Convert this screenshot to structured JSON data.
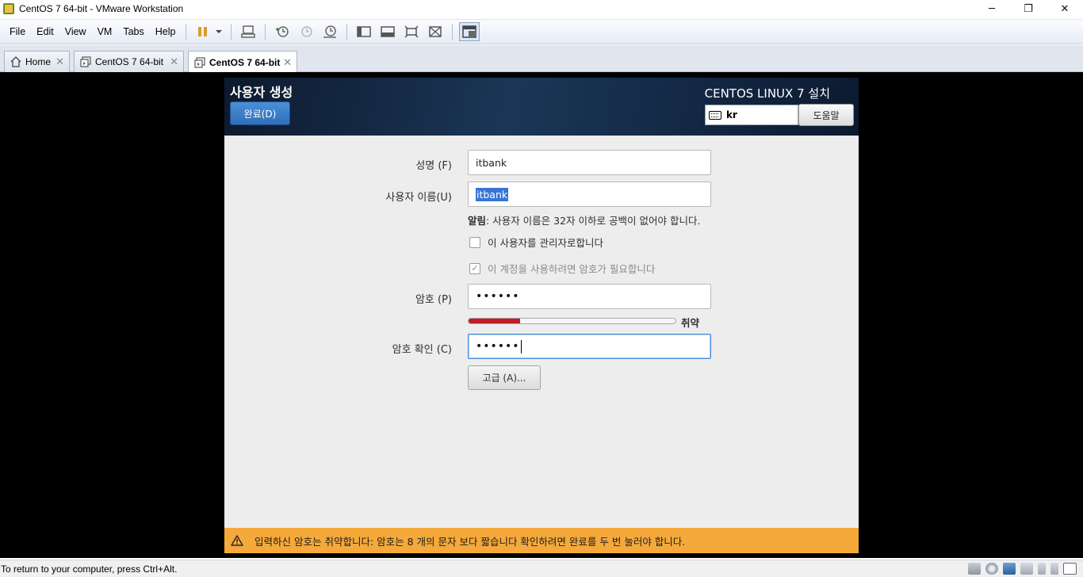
{
  "window": {
    "title": "CentOS 7 64-bit - VMware Workstation",
    "minimize": "─",
    "maximize": "❐",
    "close": "✕"
  },
  "menu": {
    "items": [
      "File",
      "Edit",
      "View",
      "VM",
      "Tabs",
      "Help"
    ]
  },
  "tabs": [
    {
      "label": "Home",
      "icon": "home-icon"
    },
    {
      "label": "CentOS 7 64-bit",
      "icon": "vm-icon"
    },
    {
      "label": "CentOS 7 64-bit",
      "icon": "vm-icon",
      "active": true
    }
  ],
  "installer": {
    "page_title": "사용자 생성",
    "done_button": "완료(D)",
    "product_title": "CENTOS LINUX 7 설치",
    "keyboard_layout": "kr",
    "help_button": "도움말",
    "full_name_label": "성명 (F)",
    "full_name_value": "itbank",
    "username_label": "사용자 이름(U)",
    "username_value": "itbank",
    "hint_prefix": "알림",
    "hint_text": ": 사용자 이름은 32자 이하로 공백이 없어야 합니다.",
    "admin_checkbox": "이 사용자를 관리자로합니다",
    "admin_checked": false,
    "require_password_checkbox": "이 계정을 사용하려면 암호가 필요합니다",
    "require_password_checked": true,
    "password_label": "암호 (P)",
    "password_value": "••••••",
    "strength_label": "취약",
    "strength_level": 0.25,
    "confirm_label": "암호 확인 (C)",
    "confirm_value": "••••••",
    "advanced_button": "고급 (A)...",
    "warning_text": "입력하신 암호는 취약합니다: 암호는 8 개의 문자 보다 짧습니다 확인하려면 완료를 두 번 눌러야 합니다."
  },
  "statusbar": {
    "text": "To return to your computer, press Ctrl+Alt."
  },
  "colors": {
    "warning": "#f5a93b",
    "accent": "#3875d7",
    "strength_weak": "#c01c28"
  }
}
